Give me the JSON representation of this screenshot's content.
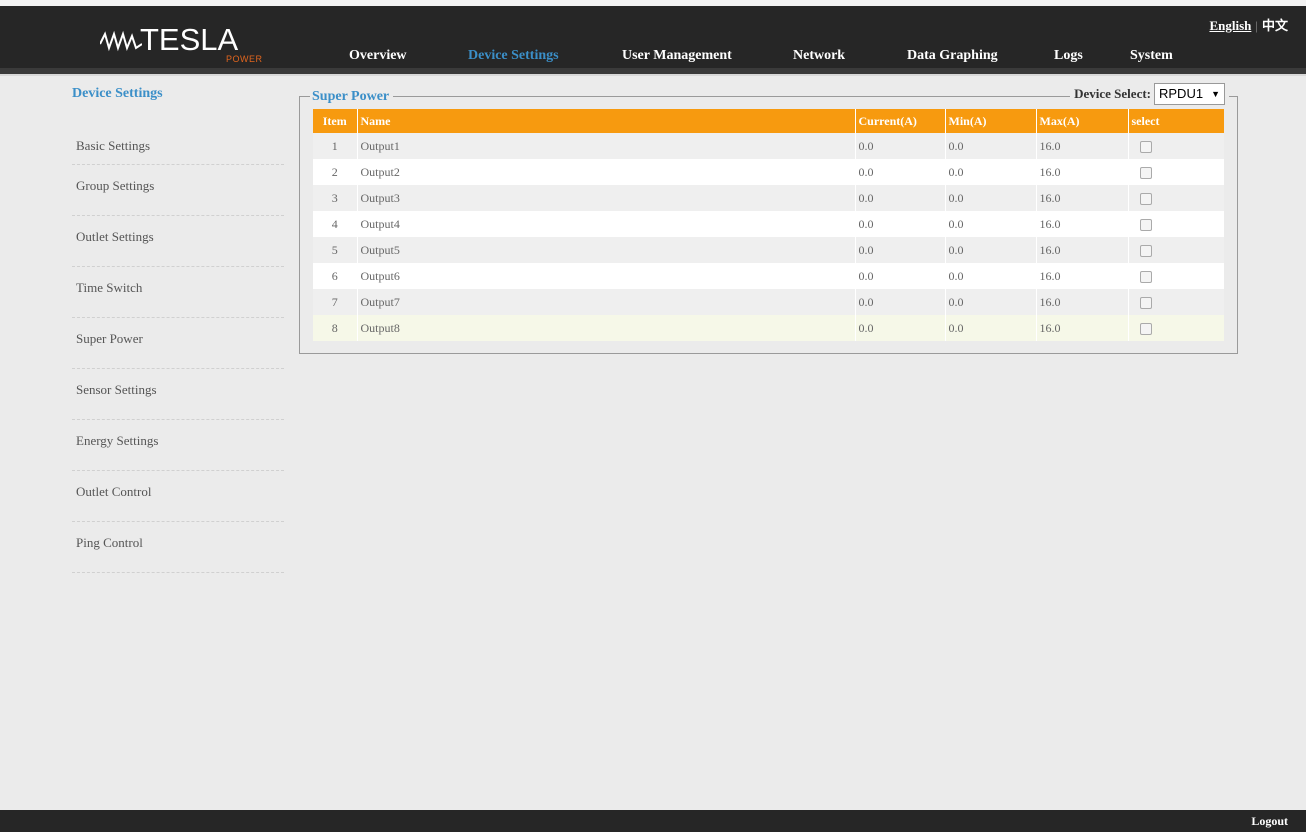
{
  "brand": {
    "name": "TESLA",
    "sub": "POWER"
  },
  "nav": [
    "Overview",
    "Device Settings",
    "User Management",
    "Network",
    "Data Graphing",
    "Logs",
    "System"
  ],
  "lang": {
    "english": "English",
    "chinese": "中文"
  },
  "sidebar": {
    "title": "Device Settings",
    "items": [
      "Basic Settings",
      "Group Settings",
      "Outlet Settings",
      "Time Switch",
      "Super Power",
      "Sensor Settings",
      "Energy Settings",
      "Outlet Control",
      "Ping Control"
    ]
  },
  "panel": {
    "legend": "Super Power",
    "device_select_label": "Device Select:",
    "device_select_value": "RPDU1"
  },
  "table": {
    "headers": [
      "Item",
      "Name",
      "Current(A)",
      "Min(A)",
      "Max(A)",
      "select"
    ],
    "rows": [
      [
        "1",
        "Output1",
        "0.0",
        "0.0",
        "16.0"
      ],
      [
        "2",
        "Output2",
        "0.0",
        "0.0",
        "16.0"
      ],
      [
        "3",
        "Output3",
        "0.0",
        "0.0",
        "16.0"
      ],
      [
        "4",
        "Output4",
        "0.0",
        "0.0",
        "16.0"
      ],
      [
        "5",
        "Output5",
        "0.0",
        "0.0",
        "16.0"
      ],
      [
        "6",
        "Output6",
        "0.0",
        "0.0",
        "16.0"
      ],
      [
        "7",
        "Output7",
        "0.0",
        "0.0",
        "16.0"
      ],
      [
        "8",
        "Output8",
        "0.0",
        "0.0",
        "16.0"
      ]
    ]
  },
  "footer": {
    "logout": "Logout"
  },
  "colors": {
    "accent": "#3b8fc8",
    "header_bg": "#262626",
    "table_header": "#f79a0f"
  }
}
